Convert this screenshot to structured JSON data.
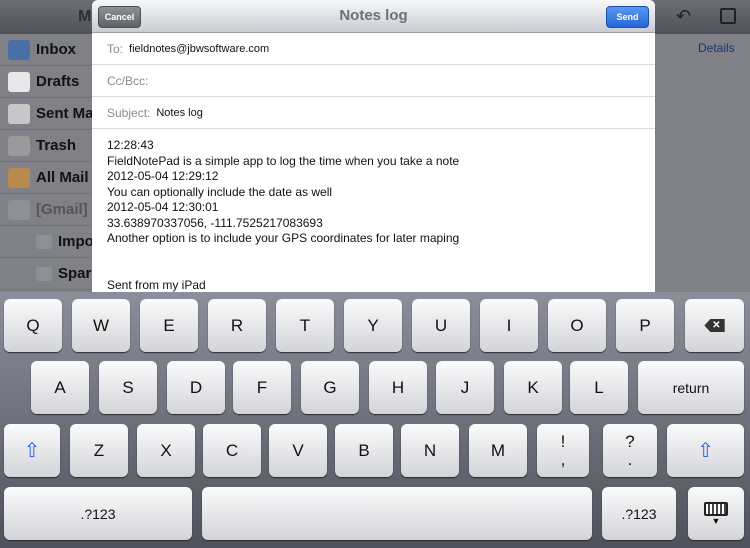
{
  "background": {
    "title_fragment": "M",
    "details": "Details",
    "sidebar": [
      {
        "label": "Inbox",
        "icon": "inbox-icon"
      },
      {
        "label": "Drafts",
        "icon": "drafts-icon"
      },
      {
        "label": "Sent Ma",
        "icon": "sent-icon"
      },
      {
        "label": "Trash",
        "icon": "trash-icon"
      },
      {
        "label": "All Mail",
        "icon": "all-mail-box-icon"
      },
      {
        "label": "[Gmail]",
        "icon": "folder-icon"
      },
      {
        "label": "Impo",
        "icon": "folder-icon"
      },
      {
        "label": "Spar",
        "icon": "folder-icon"
      }
    ]
  },
  "compose": {
    "title": "Notes log",
    "cancel": "Cancel",
    "send": "Send",
    "to_label": "To:",
    "to": "fieldnotes@jbwsoftware.com",
    "cc_label": "Cc/Bcc:",
    "subject_label": "Subject:",
    "subject": "Notes log",
    "body": [
      "12:28:43",
      "FieldNotePad is a simple app to log the time when you take a note",
      "2012-05-04 12:29:12",
      "You can optionally include the date as well",
      "2012-05-04 12:30:01",
      "33.638970337056, -111.7525217083693",
      "Another option is to include your GPS coordinates for later maping",
      "",
      "",
      "Sent from my iPad"
    ]
  },
  "keyboard": {
    "row1": [
      "Q",
      "W",
      "E",
      "R",
      "T",
      "Y",
      "U",
      "I",
      "O",
      "P"
    ],
    "row2": [
      "A",
      "S",
      "D",
      "F",
      "G",
      "H",
      "J",
      "K",
      "L"
    ],
    "return": "return",
    "row3": [
      "Z",
      "X",
      "C",
      "V",
      "B",
      "N",
      "M"
    ],
    "excl_comma": [
      "!",
      ","
    ],
    "question_period": [
      "?",
      "."
    ],
    "numbers": ".?123",
    "shift_color": "#2f63d9"
  }
}
